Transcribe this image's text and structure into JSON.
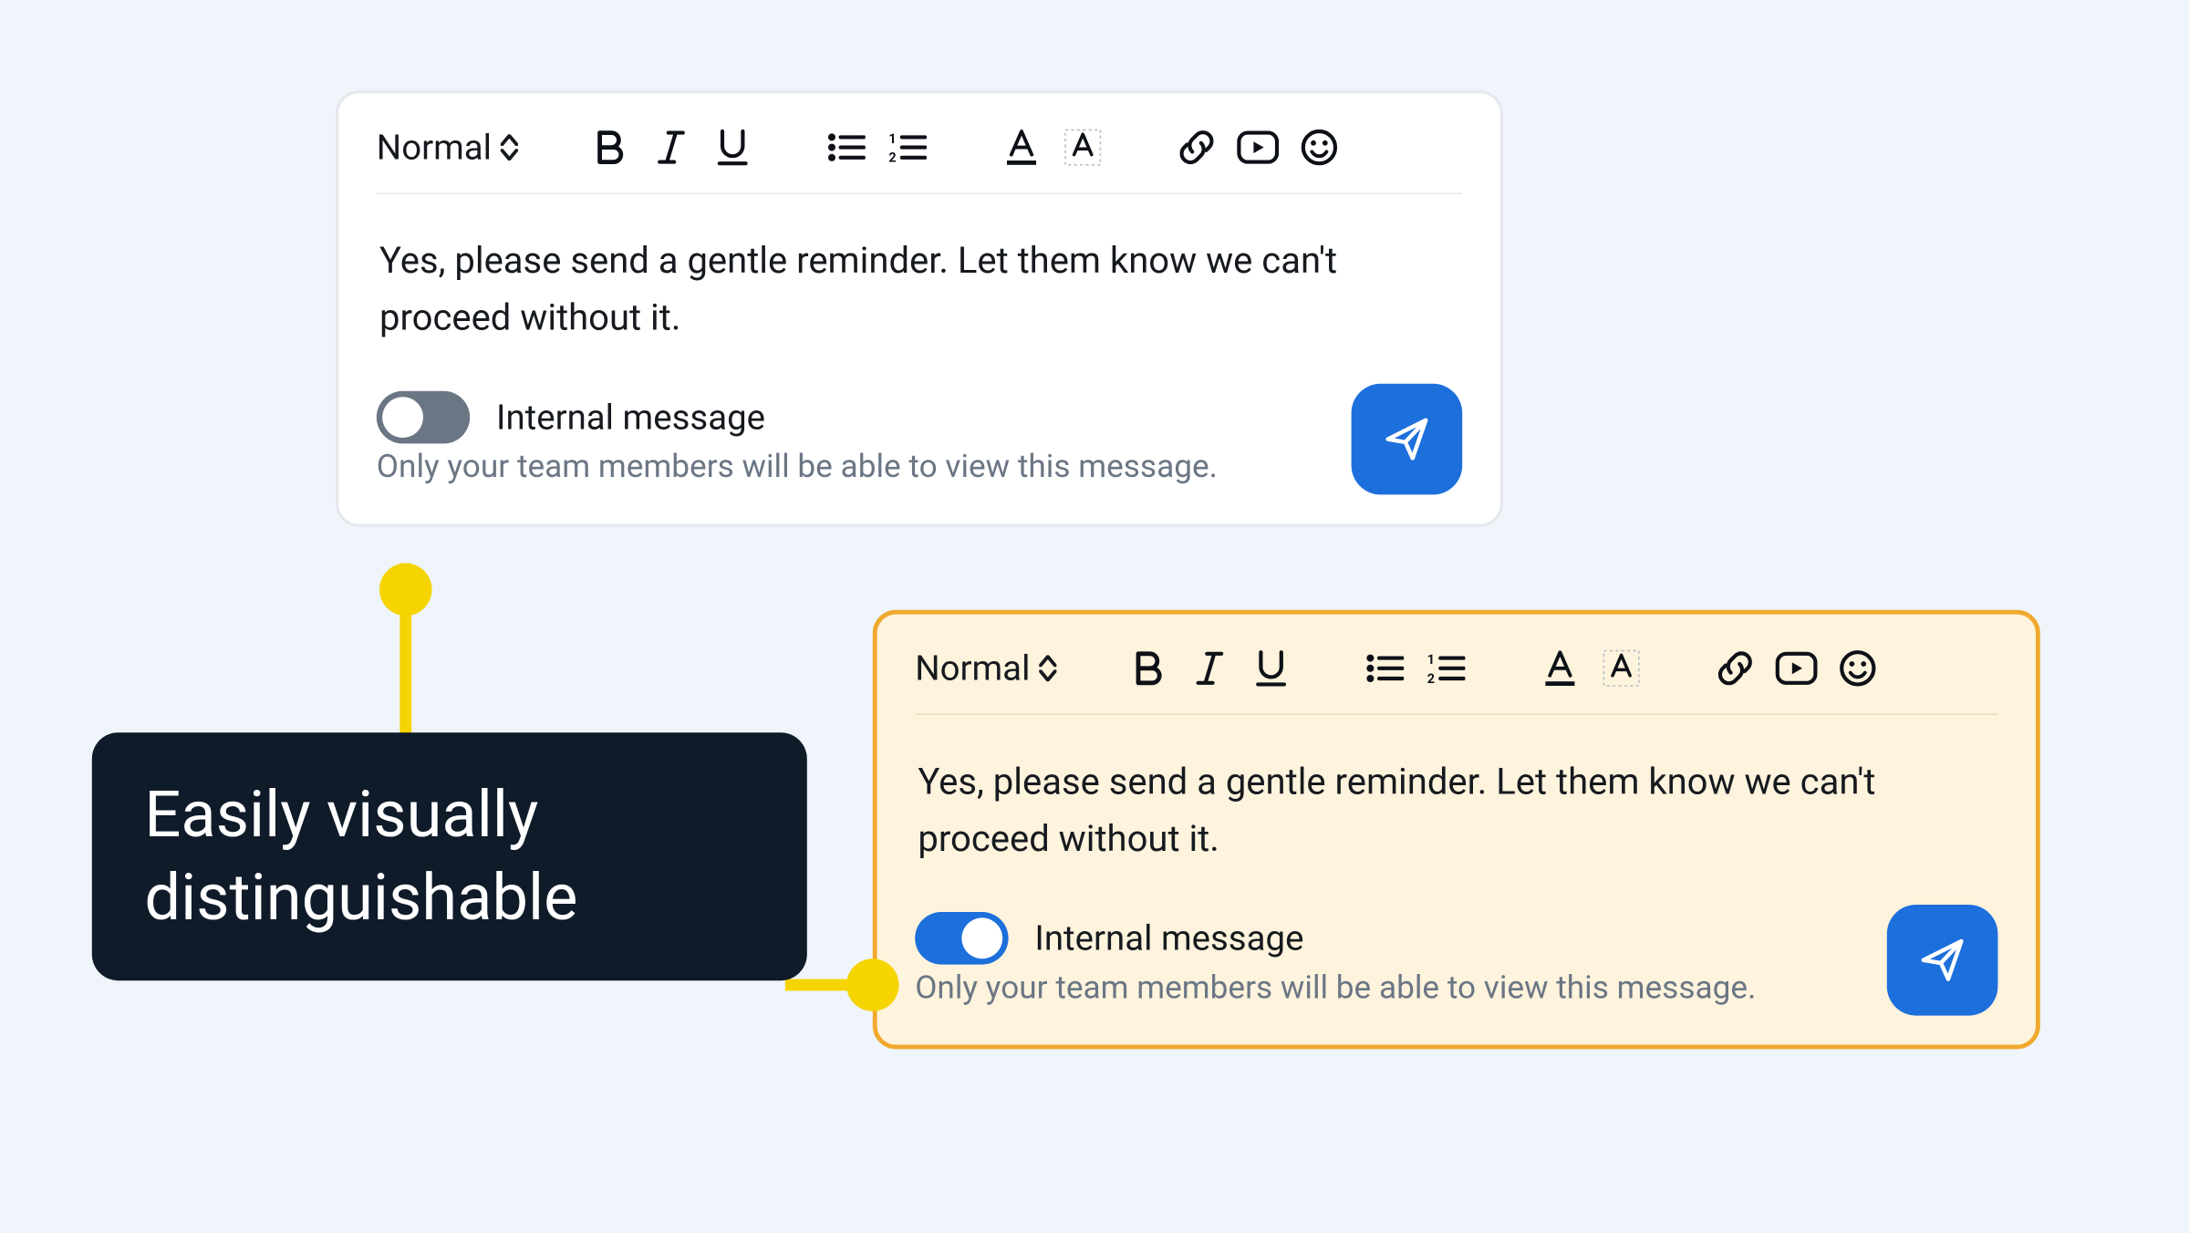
{
  "toolbar": {
    "style_label": "Normal"
  },
  "message": {
    "body": "Yes, please send a gentle reminder. Let them know we can't proceed without it."
  },
  "toggle": {
    "label": "Internal message",
    "hint": "Only your team members will be able to view this message."
  },
  "callout": {
    "text": "Easily visually distinguishable"
  },
  "composers": [
    {
      "variant": "white",
      "toggle_on": false
    },
    {
      "variant": "yellow",
      "toggle_on": true
    }
  ]
}
